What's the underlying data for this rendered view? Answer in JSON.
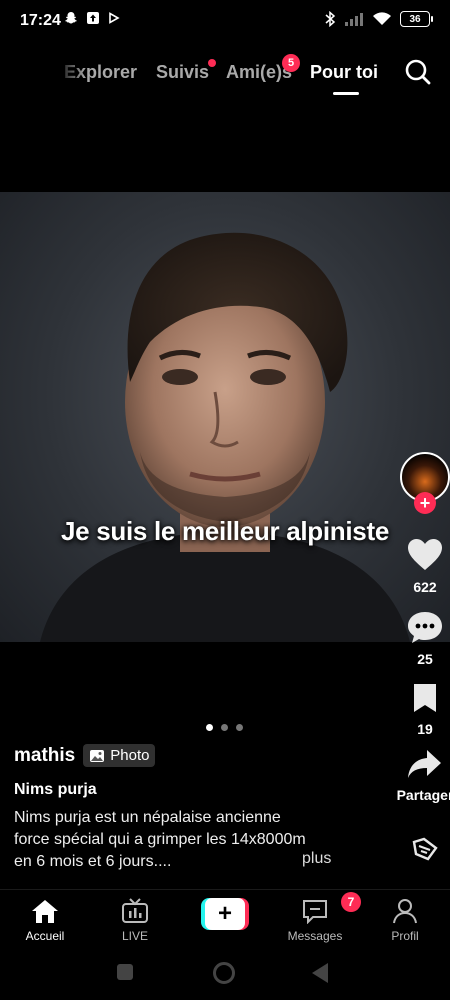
{
  "status_bar": {
    "time": "17:24",
    "battery": "36",
    "icons": [
      "snapchat-icon",
      "upload-icon",
      "play-icon",
      "bluetooth-icon",
      "signal-icon",
      "wifi-icon",
      "battery-icon"
    ]
  },
  "top_nav": {
    "tabs": [
      {
        "label": "Explorer",
        "active": false
      },
      {
        "label": "Suivis",
        "active": false,
        "dot": true
      },
      {
        "label": "Ami(e)s",
        "active": false,
        "badge": "5"
      },
      {
        "label": "Pour toi",
        "active": true
      }
    ]
  },
  "post": {
    "overlay_caption": "Je suis le meilleur alpiniste",
    "carousel_count": 3,
    "carousel_active": 1,
    "username": "mathis",
    "media_tag": "Photo",
    "title": "Nims purja",
    "description": "Nims purja est un népalaise ancienne force spécial qui a grimper les 14x8000m en 6 mois et 6 jours....",
    "more_label": "plus"
  },
  "rail": {
    "likes": "622",
    "comments": "25",
    "saves": "19",
    "share_label": "Partager"
  },
  "bottom_nav": {
    "home": "Accueil",
    "live": "LIVE",
    "messages": "Messages",
    "messages_badge": "7",
    "profile": "Profil"
  },
  "colors": {
    "accent": "#fe2c55",
    "cyan": "#25f4ee",
    "background": "#000000"
  }
}
